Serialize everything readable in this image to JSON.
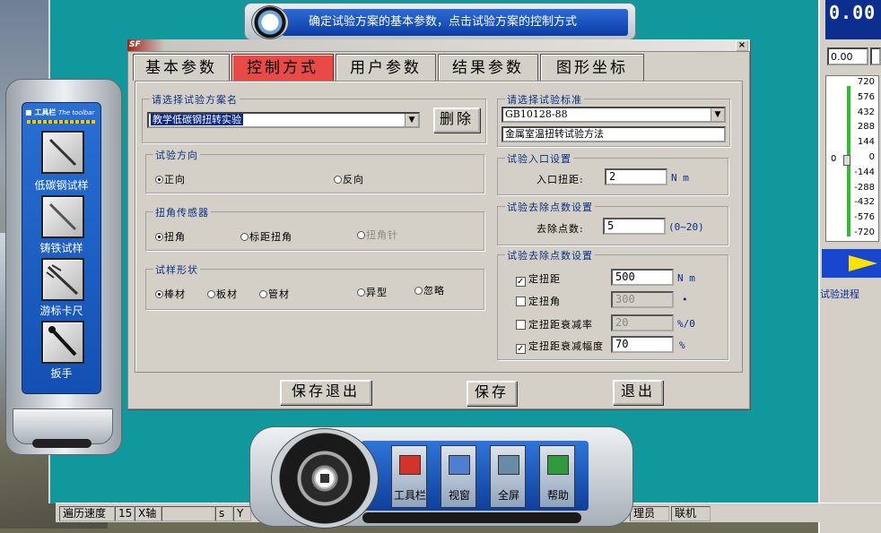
{
  "banner": {
    "text": "确定试验方案的基本参数，点击试验方案的控制方式"
  },
  "right_panel": {
    "big_value": "0.00",
    "input_value": "0.00",
    "scale_ticks": [
      "720",
      "576",
      "432",
      "288",
      "144",
      "0",
      "-144",
      "-288",
      "-432",
      "-576",
      "-720"
    ],
    "zero_label": "0",
    "progress_label": "试验进程"
  },
  "status_bar": {
    "items": [
      "遍历速度",
      "15",
      "X轴",
      "",
      "s",
      "Y",
      "理员",
      "联机"
    ]
  },
  "toolbar": {
    "title": "工具栏",
    "subtitle": "The toolbar",
    "tools": [
      {
        "label": "低碳钢试样",
        "icon": "rod-icon"
      },
      {
        "label": "铸铁试样",
        "icon": "rod-icon"
      },
      {
        "label": "游标卡尺",
        "icon": "caliper-icon"
      },
      {
        "label": "扳手",
        "icon": "wrench-icon"
      }
    ]
  },
  "dock": {
    "buttons": [
      {
        "label": "工具栏",
        "icon": "toolbox-icon"
      },
      {
        "label": "视窗",
        "icon": "window-icon"
      },
      {
        "label": "全屏",
        "icon": "fullscreen-icon"
      },
      {
        "label": "帮助",
        "icon": "help-icon"
      }
    ]
  },
  "dialog": {
    "close_label": "×",
    "tabs": [
      "基本参数",
      "控制方式",
      "用户参数",
      "结果参数",
      "图形坐标"
    ],
    "active_tab": "控制方式",
    "scheme_group": {
      "title": "请选择试验方案名",
      "selected": "教学低碳钢扭转实验",
      "delete_label": "删除"
    },
    "direction_group": {
      "title": "试验方向",
      "options": [
        {
          "label": "正向",
          "checked": true
        },
        {
          "label": "反向",
          "checked": false
        }
      ]
    },
    "sensor_group": {
      "title": "扭角传感器",
      "options": [
        {
          "label": "扭角",
          "checked": true,
          "disabled": false
        },
        {
          "label": "标距扭角",
          "checked": false,
          "disabled": false
        },
        {
          "label": "扭角针",
          "checked": false,
          "disabled": true
        }
      ]
    },
    "shape_group": {
      "title": "试样形状",
      "options": [
        {
          "label": "棒材",
          "checked": true
        },
        {
          "label": "板材",
          "checked": false
        },
        {
          "label": "管材",
          "checked": false
        },
        {
          "label": "异型",
          "checked": false
        },
        {
          "label": "忽略",
          "checked": false
        }
      ]
    },
    "standard_group": {
      "title": "请选择试验标准",
      "selected": "GB10128-88",
      "description": "金属室温扭转试验方法"
    },
    "entry_group": {
      "title": "试验入口设置",
      "label": "入口扭距:",
      "value": "2",
      "unit": "N m"
    },
    "remove_group": {
      "title": "试验去除点数设置",
      "label": "去除点数:",
      "value": "5",
      "range": "(0~20)"
    },
    "stop_group": {
      "title": "试验去除点数设置",
      "rows": [
        {
          "label": "定扭距",
          "checked": true,
          "value": "500",
          "unit": "N m",
          "disabled": false
        },
        {
          "label": "定扭角",
          "checked": false,
          "value": "300",
          "unit": "•",
          "disabled": true
        },
        {
          "label": "定扭距衰减率",
          "checked": false,
          "value": "20",
          "unit": "%/0",
          "disabled": true
        },
        {
          "label": "定扭距衰减幅度",
          "checked": true,
          "value": "70",
          "unit": "%",
          "disabled": false
        }
      ]
    },
    "buttons": {
      "save_exit": "保存退出",
      "save": "保存",
      "exit": "退出"
    }
  },
  "colors": {
    "active_tab": "#e84b45",
    "main_bg": "#10989c",
    "accent_blue": "#1450b3",
    "arrow": "#ffe100"
  }
}
